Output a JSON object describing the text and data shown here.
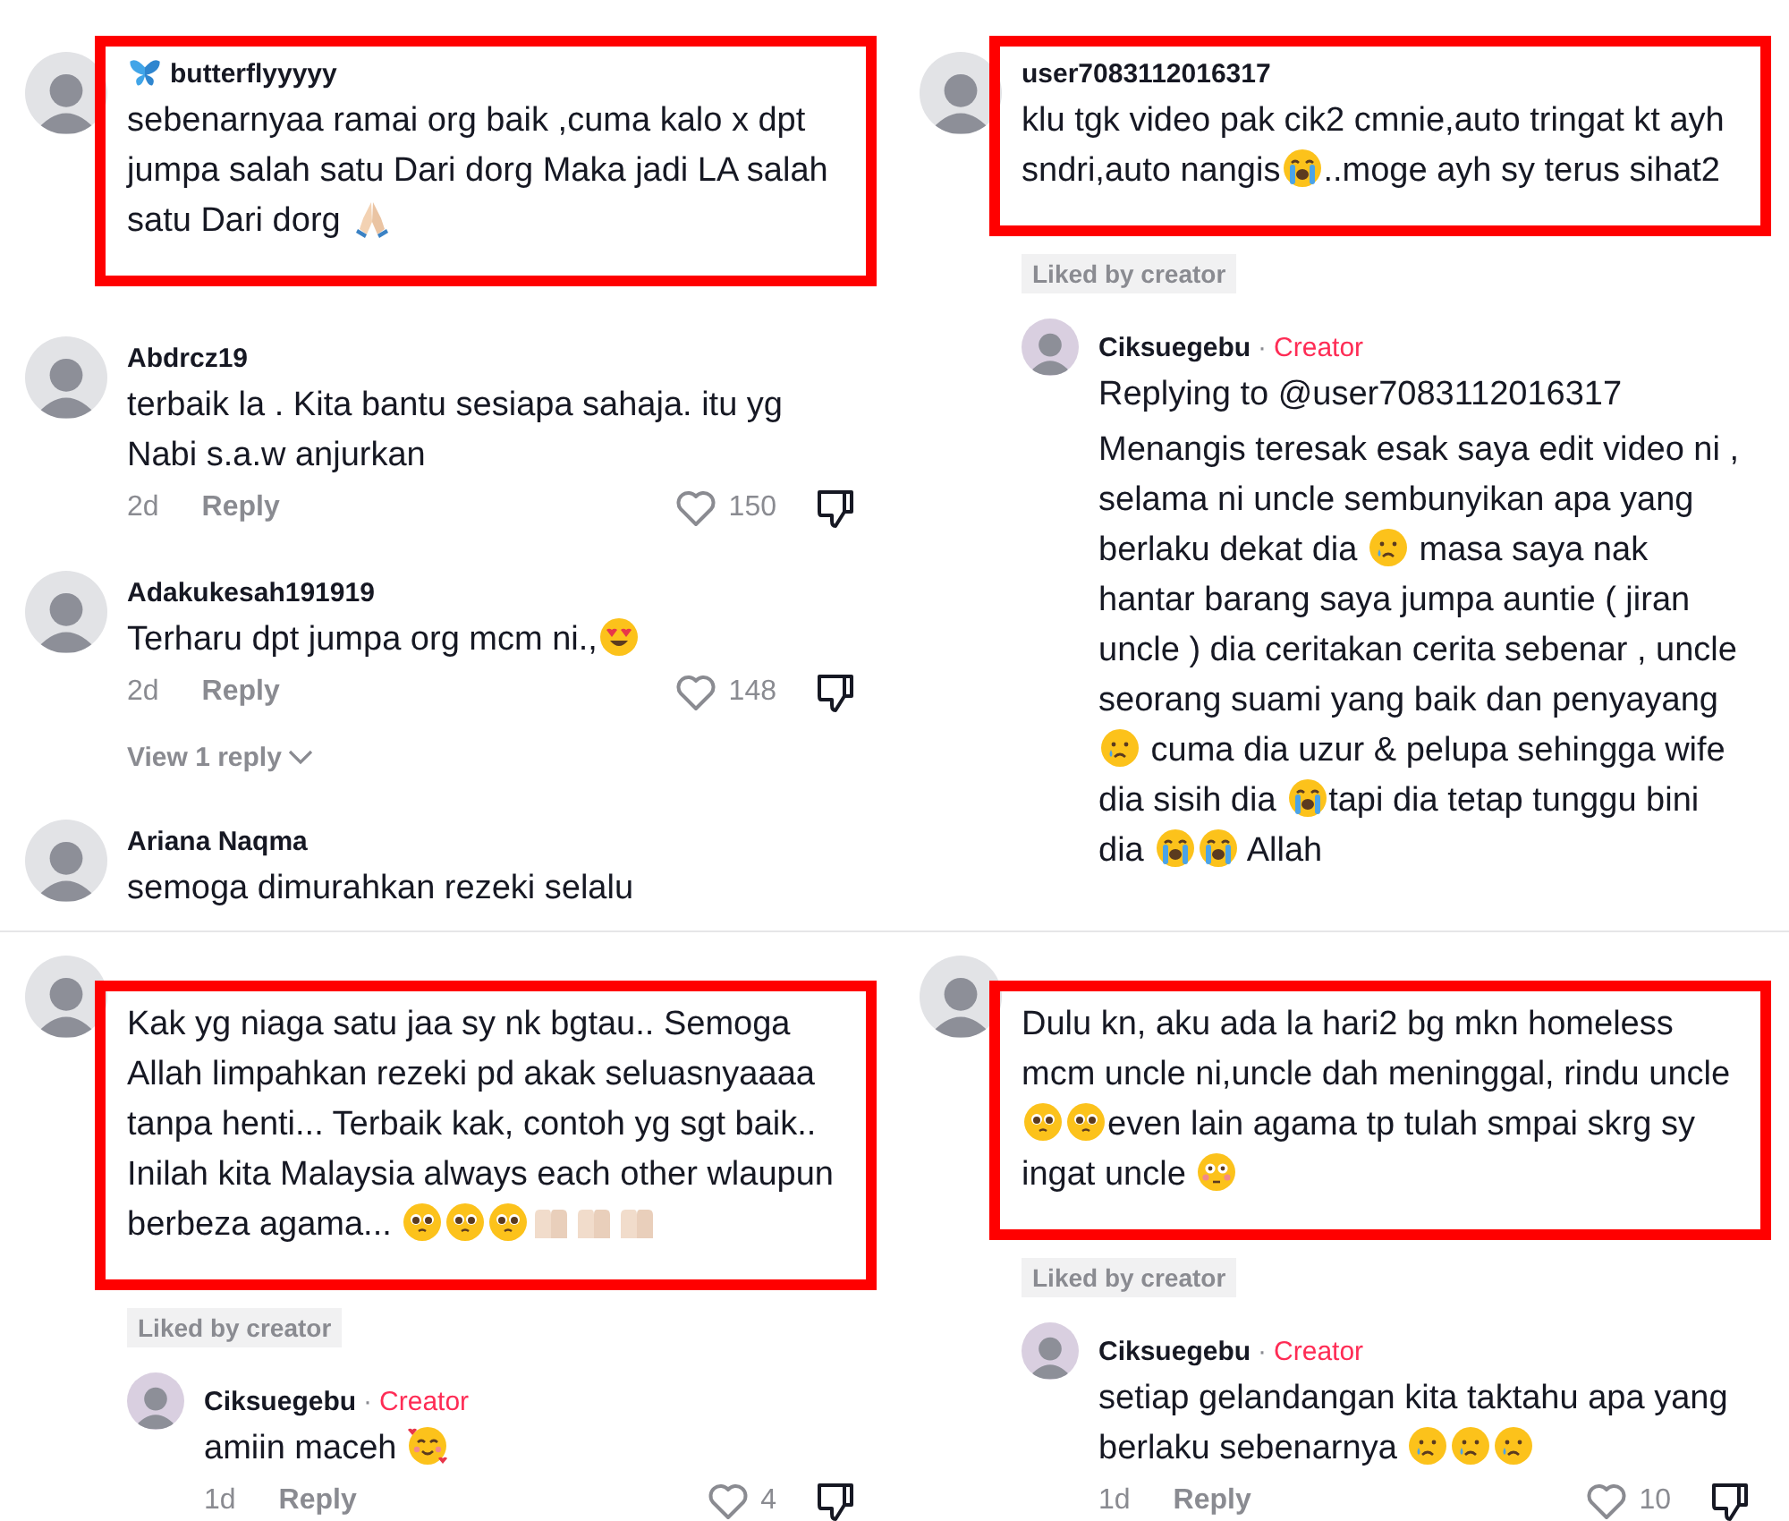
{
  "panels": [
    {
      "comments": [
        {
          "user": "butterflyyyyy",
          "user_badge": {
            "kind": "butterfly"
          },
          "highlighted": true,
          "body": [
            "sebenarnyaa ramai org baik ,cuma kalo x dpt jumpa salah satu Dari dorg Maka jadi LA salah satu Dari dorg ",
            {
              "kind": "pray"
            }
          ]
        },
        {
          "user": "Abdrcz19",
          "highlighted": false,
          "body": [
            "terbaik la . Kita bantu sesiapa sahaja. itu yg Nabi s.a.w anjurkan"
          ],
          "time": "2d",
          "reply_label": "Reply",
          "likes": "150"
        },
        {
          "user": "Adakukesah191919",
          "highlighted": false,
          "body": [
            "Terharu dpt jumpa org mcm ni.,",
            {
              "kind": "heart_eyes"
            }
          ],
          "time": "2d",
          "reply_label": "Reply",
          "likes": "148",
          "view_replies": "View 1 reply"
        },
        {
          "user": "Ariana Naqma",
          "highlighted": false,
          "body": [
            "semoga dimurahkan rezeki selalu"
          ]
        }
      ]
    },
    {
      "comments": [
        {
          "user": "user7083112016317",
          "highlighted": true,
          "body": [
            "klu tgk video pak cik2 cmnie,auto tringat kt ayh sndri,auto nangis",
            {
              "kind": "sob"
            },
            "..moge ayh sy terus sihat2"
          ],
          "liked_by_creator": "Liked by creator",
          "replies": [
            {
              "user": "Ciksuegebu",
              "separator": "·",
              "role": "Creator",
              "reply_to": "Replying to @user7083112016317",
              "body": [
                "Menangis teresak esak saya edit video ni , selama ni uncle sembunyikan apa yang berlaku dekat dia ",
                {
                  "kind": "cry"
                },
                " masa saya nak hantar barang saya jumpa auntie ( jiran uncle ) dia ceritakan cerita sebenar , uncle seorang suami yang baik dan penyayang ",
                {
                  "kind": "cry"
                },
                " cuma dia uzur & pelupa sehingga wife dia sisih dia ",
                {
                  "kind": "sob"
                },
                "tapi dia tetap tunggu bini dia ",
                {
                  "kind": "sob"
                },
                {
                  "kind": "sob"
                },
                " Allah"
              ]
            }
          ]
        }
      ]
    },
    {
      "comments": [
        {
          "highlighted": true,
          "body": [
            "Kak yg niaga satu jaa sy nk bgtau.. Semoga Allah limpahkan rezeki pd akak seluasnyaaaa tanpa henti... Terbaik kak, contoh yg sgt baik.. Inilah kita Malaysia always each other wlaupun berbeza agama... ",
            {
              "kind": "pleading"
            },
            {
              "kind": "pleading"
            },
            {
              "kind": "pleading"
            },
            {
              "kind": "palms"
            },
            {
              "kind": "palms"
            },
            {
              "kind": "palms"
            }
          ],
          "liked_by_creator": "Liked by creator",
          "replies": [
            {
              "user": "Ciksuegebu",
              "separator": "·",
              "role": "Creator",
              "body": [
                "amiin maceh ",
                {
                  "kind": "hearts"
                }
              ],
              "time": "1d",
              "reply_label": "Reply",
              "likes": "4"
            }
          ]
        }
      ]
    },
    {
      "comments": [
        {
          "highlighted": true,
          "body": [
            "Dulu kn, aku ada la hari2 bg mkn homeless mcm uncle ni,uncle dah meninggal, rindu uncle ",
            {
              "kind": "pleading"
            },
            {
              "kind": "pleading"
            },
            "even lain agama tp tulah smpai skrg sy ingat uncle ",
            {
              "kind": "flushed"
            }
          ],
          "liked_by_creator": "Liked by creator",
          "replies": [
            {
              "user": "Ciksuegebu",
              "separator": "·",
              "role": "Creator",
              "body": [
                "setiap gelandangan kita taktahu apa yang berlaku sebenarnya ",
                {
                  "kind": "cry"
                },
                {
                  "kind": "cry"
                },
                {
                  "kind": "cry"
                }
              ],
              "time": "1d",
              "reply_label": "Reply",
              "likes": "10"
            }
          ]
        }
      ]
    }
  ]
}
